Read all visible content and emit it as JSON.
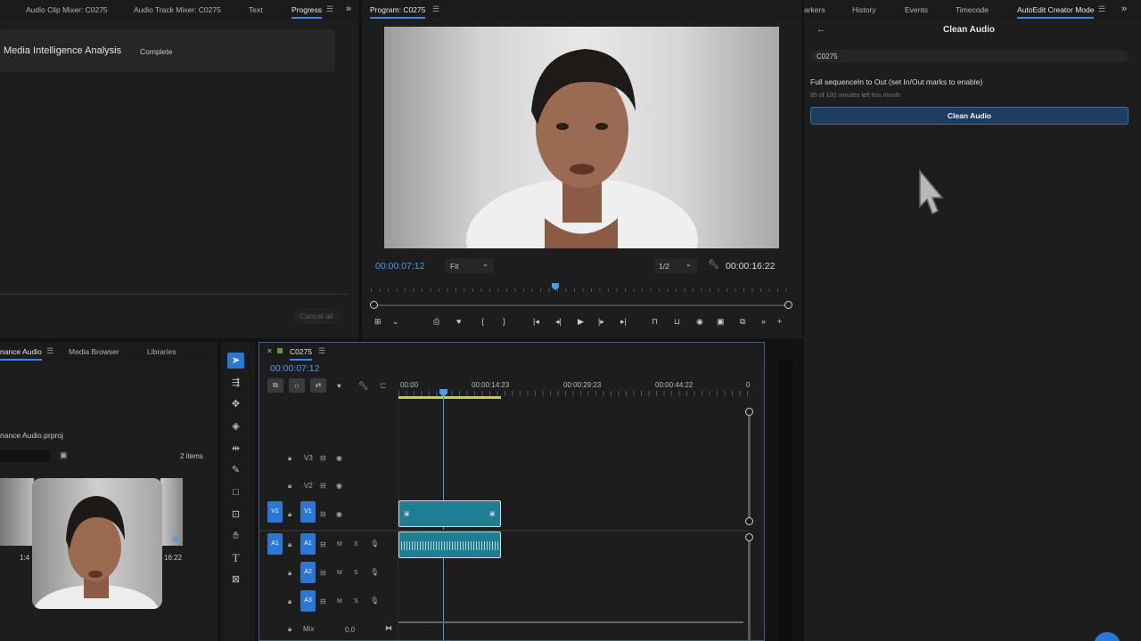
{
  "progress_panel": {
    "tabs": [
      "Audio Clip Mixer: C0275",
      "Audio Track Mixer: C0275",
      "Text",
      "Progress"
    ],
    "job_name": "Media Intelligence Analysis",
    "job_status": "Complete",
    "cancel_all": "Cancel all"
  },
  "program_monitor": {
    "title": "Program: C0275",
    "timecode_current": "00:00:07:12",
    "zoom": "Fit",
    "resolution": "1/2",
    "timecode_duration": "00:00:16:22",
    "playhead_fraction": 0.44
  },
  "right_panel": {
    "tabs": [
      "arkers",
      "History",
      "Events",
      "Timecode",
      "AutoEdit Creator Mode"
    ],
    "title": "Clean Audio",
    "sequence_name": "C0275",
    "range_label": "Full sequenceIn to Out (set In/Out marks to enable)",
    "quota": "85 of 100 minutes left this month",
    "clean_button": "Clean Audio"
  },
  "project_panel": {
    "tabs": [
      "nance Audio",
      "Media Browser",
      "Libraries"
    ],
    "project_file": "nance Audio.prproj",
    "item_count": "2 items",
    "thumb_left_label": "1:4",
    "thumb_right_label": "16:22"
  },
  "timeline": {
    "sequence_tab": "C0275",
    "timecode": "00:00:07:12",
    "ruler_labels": [
      "00:00",
      "00:00:14:23",
      "00:00:29:23",
      "00:00:44:22",
      "0"
    ],
    "video_tracks": [
      "V3",
      "V2",
      "V1"
    ],
    "audio_tracks": [
      "A1",
      "A2",
      "A3"
    ],
    "source_v": "V1",
    "source_a": "A1",
    "mute_label": "M",
    "solo_label": "S",
    "mix_label": "Mix",
    "mix_value": "0.0"
  }
}
